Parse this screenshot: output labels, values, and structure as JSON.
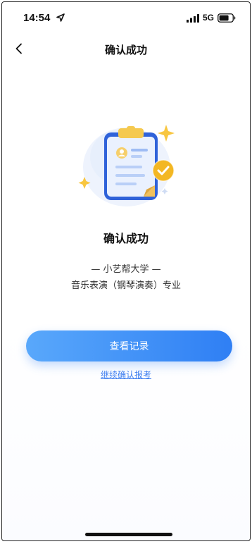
{
  "status_bar": {
    "time": "14:54",
    "network": "5G",
    "icons": [
      "location-arrow-icon",
      "signal-icon",
      "battery-icon"
    ]
  },
  "nav": {
    "title": "确认成功",
    "back_icon": "chevron-left-icon"
  },
  "illustration": {
    "icon": "clipboard-check-icon",
    "accent_colors": [
      "#2f6de1",
      "#f5b722",
      "#dfe9fb"
    ]
  },
  "result": {
    "title": "确认成功",
    "school": "— 小艺帮大学 —",
    "major": "音乐表演（钢琴演奏）专业"
  },
  "actions": {
    "view_records_label": "查看记录",
    "continue_label": "继续确认报考"
  },
  "colors": {
    "primary": "#3d86f6",
    "link": "#3d7ef0"
  }
}
